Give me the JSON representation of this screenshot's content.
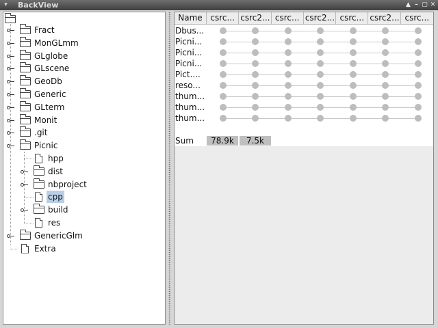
{
  "window": {
    "title": "BackView",
    "controls": [
      "▲",
      "–",
      "▢",
      "✕"
    ]
  },
  "tree": {
    "items": [
      {
        "label": "Fract",
        "type": "folder",
        "expandable": true
      },
      {
        "label": "MonGLmm",
        "type": "folder",
        "expandable": true
      },
      {
        "label": "GLglobe",
        "type": "folder",
        "expandable": true
      },
      {
        "label": "GLscene",
        "type": "folder",
        "expandable": true
      },
      {
        "label": "GeoDb",
        "type": "folder",
        "expandable": true
      },
      {
        "label": "Generic",
        "type": "folder",
        "expandable": true
      },
      {
        "label": "GLterm",
        "type": "folder",
        "expandable": true
      },
      {
        "label": "Monit",
        "type": "folder",
        "expandable": true
      },
      {
        "label": ".git",
        "type": "folder",
        "expandable": true
      },
      {
        "label": "Picnic",
        "type": "folder",
        "expanded": true
      },
      {
        "label": "hpp",
        "type": "file",
        "child": true
      },
      {
        "label": "dist",
        "type": "folder",
        "child": true,
        "expandable": true
      },
      {
        "label": "nbproject",
        "type": "folder",
        "child": true,
        "expandable": true
      },
      {
        "label": "cpp",
        "type": "file",
        "child": true,
        "selected": true
      },
      {
        "label": "build",
        "type": "folder",
        "child": true,
        "expandable": true
      },
      {
        "label": "res",
        "type": "file",
        "child": true
      },
      {
        "label": "GenericGlm",
        "type": "folder",
        "expandable": true
      },
      {
        "label": "Extra",
        "type": "file"
      }
    ]
  },
  "table": {
    "headers": [
      "Name",
      "csrc...",
      "csrc2...",
      "csrc...",
      "csrc2...",
      "csrc...",
      "csrc2...",
      "csrc..."
    ],
    "rows": [
      "Dbus...",
      "Picni...",
      "Picni...",
      "Picni...",
      "Pict....",
      "reso...",
      "thum...",
      "thum...",
      "thum..."
    ],
    "sum": {
      "label": "Sum",
      "values": [
        "78.9k",
        "7.5k"
      ]
    }
  }
}
